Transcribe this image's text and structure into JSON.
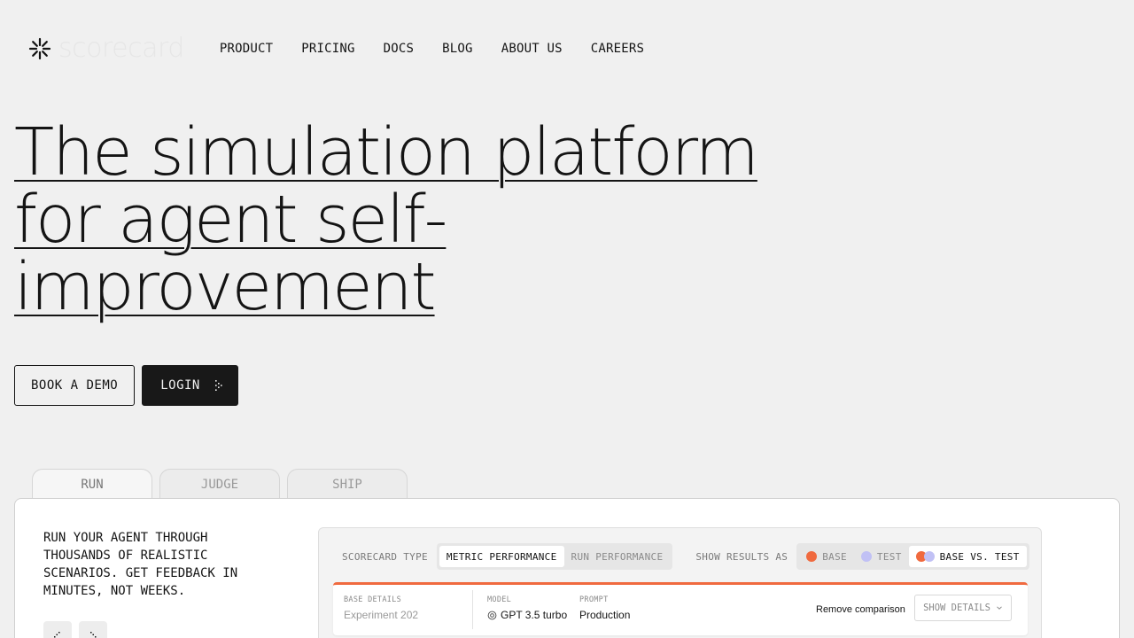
{
  "brand": {
    "name": "scorecard",
    "icon": "asterisk-logo-icon"
  },
  "nav": [
    {
      "id": "product",
      "label": "PRODUCT"
    },
    {
      "id": "pricing",
      "label": "PRICING"
    },
    {
      "id": "docs",
      "label": "DOCS"
    },
    {
      "id": "blog",
      "label": "BLOG"
    },
    {
      "id": "about",
      "label": "ABOUT US"
    },
    {
      "id": "careers",
      "label": "CAREERS"
    }
  ],
  "hero": {
    "line1": "The simulation platform",
    "line2": "for agent self-",
    "line3": "improvement"
  },
  "cta": {
    "demo": "BOOK A DEMO",
    "login": "LOGIN"
  },
  "tabs": [
    {
      "label": "RUN",
      "active": true
    },
    {
      "label": "JUDGE",
      "active": false
    },
    {
      "label": "SHIP",
      "active": false
    }
  ],
  "panel": {
    "description": "RUN YOUR AGENT THROUGH THOUSANDS OF REALISTIC SCENARIOS. GET FEEDBACK IN MINUTES, NOT WEEKS."
  },
  "dashboard": {
    "type_label": "SCORECARD TYPE",
    "type_options": [
      "METRIC PERFORMANCE",
      "RUN PERFORMANCE"
    ],
    "results_label": "SHOW RESULTS AS",
    "results_options": [
      "BASE",
      "TEST",
      "BASE VS. TEST"
    ],
    "base_details_label": "BASE DETAILS",
    "base_details_value": "Experiment 202",
    "model_label": "MODEL",
    "model_value": "GPT 3.5 turbo",
    "prompt_label": "PROMPT",
    "prompt_value": "Production",
    "remove_label": "Remove comparison",
    "details_label": "SHOW DETAILS"
  },
  "colors": {
    "base": "#f06a3f",
    "test": "#c1c1f5",
    "background": "#f0f0f0",
    "ink": "#141414"
  }
}
